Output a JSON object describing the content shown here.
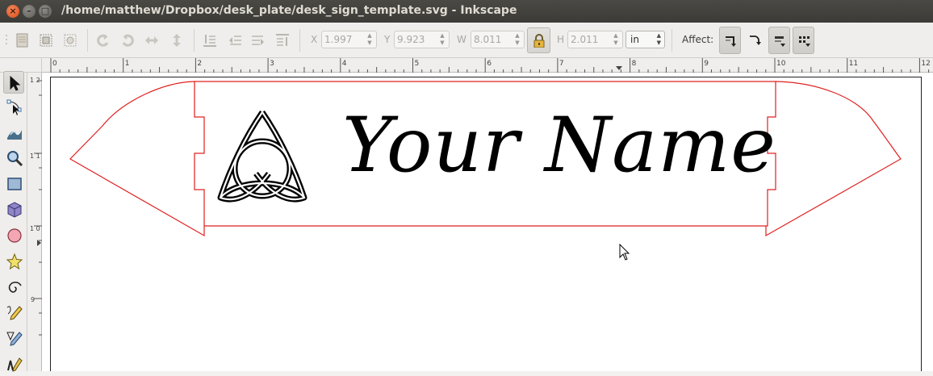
{
  "window": {
    "title": "/home/matthew/Dropbox/desk_plate/desk_sign_template.svg - Inkscape",
    "close_glyph": "×",
    "minimize_glyph": "–",
    "maximize_glyph": "□"
  },
  "toolbar": {
    "x_label": "X",
    "x_value": "1.997",
    "y_label": "Y",
    "y_value": "9.923",
    "w_label": "W",
    "w_value": "8.011",
    "h_label": "H",
    "h_value": "2.011",
    "unit": "in",
    "affect_label": "Affect:",
    "icons": [
      "select-all-icon",
      "select-all-layers-icon",
      "deselect-icon",
      "rotate-ccw-icon",
      "rotate-cw-icon",
      "flip-horizontal-icon",
      "flip-vertical-icon",
      "lower-to-bottom-icon",
      "lower-icon",
      "raise-icon",
      "raise-to-top-icon",
      "lock-icon",
      "scale-stroke-icon",
      "scale-corners-icon",
      "move-gradients-icon",
      "move-patterns-icon"
    ]
  },
  "ruler": {
    "h_labels": [
      "0",
      "1",
      "2",
      "3",
      "4",
      "5",
      "6",
      "7",
      "8",
      "9",
      "10",
      "11",
      "12"
    ],
    "v_labels": [
      "1 2",
      "1 1",
      "1 0",
      "9"
    ]
  },
  "tools": [
    "selector-tool-icon",
    "node-tool-icon",
    "tweak-tool-icon",
    "zoom-tool-icon",
    "rectangle-tool-icon",
    "3d-box-tool-icon",
    "ellipse-tool-icon",
    "star-tool-icon",
    "spiral-tool-icon",
    "pencil-tool-icon",
    "pen-tool-icon",
    "calligraphy-tool-icon"
  ],
  "canvas": {
    "sign_text": "Your Name",
    "outline_color": "#e02020",
    "text_color": "#000000"
  }
}
